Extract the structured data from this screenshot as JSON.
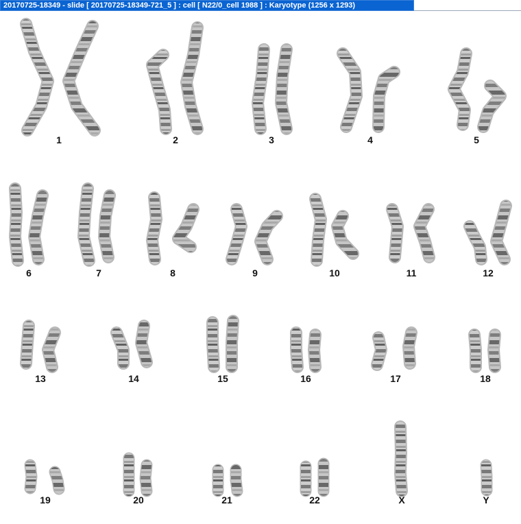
{
  "window": {
    "title": "20170725-18349 - slide [ 20170725-18349-721_5 ] : cell [ N22/0_cell 1988 ] : Karyotype  (1256 x 1293)"
  },
  "karyotype": {
    "chromosomes": [
      {
        "label": "1"
      },
      {
        "label": "2"
      },
      {
        "label": "3"
      },
      {
        "label": "4"
      },
      {
        "label": "5"
      },
      {
        "label": "6"
      },
      {
        "label": "7"
      },
      {
        "label": "8"
      },
      {
        "label": "9"
      },
      {
        "label": "10"
      },
      {
        "label": "11"
      },
      {
        "label": "12"
      },
      {
        "label": "13"
      },
      {
        "label": "14"
      },
      {
        "label": "15"
      },
      {
        "label": "16"
      },
      {
        "label": "17"
      },
      {
        "label": "18"
      },
      {
        "label": "19"
      },
      {
        "label": "20"
      },
      {
        "label": "21"
      },
      {
        "label": "22"
      },
      {
        "label": "X"
      },
      {
        "label": "Y"
      }
    ]
  }
}
